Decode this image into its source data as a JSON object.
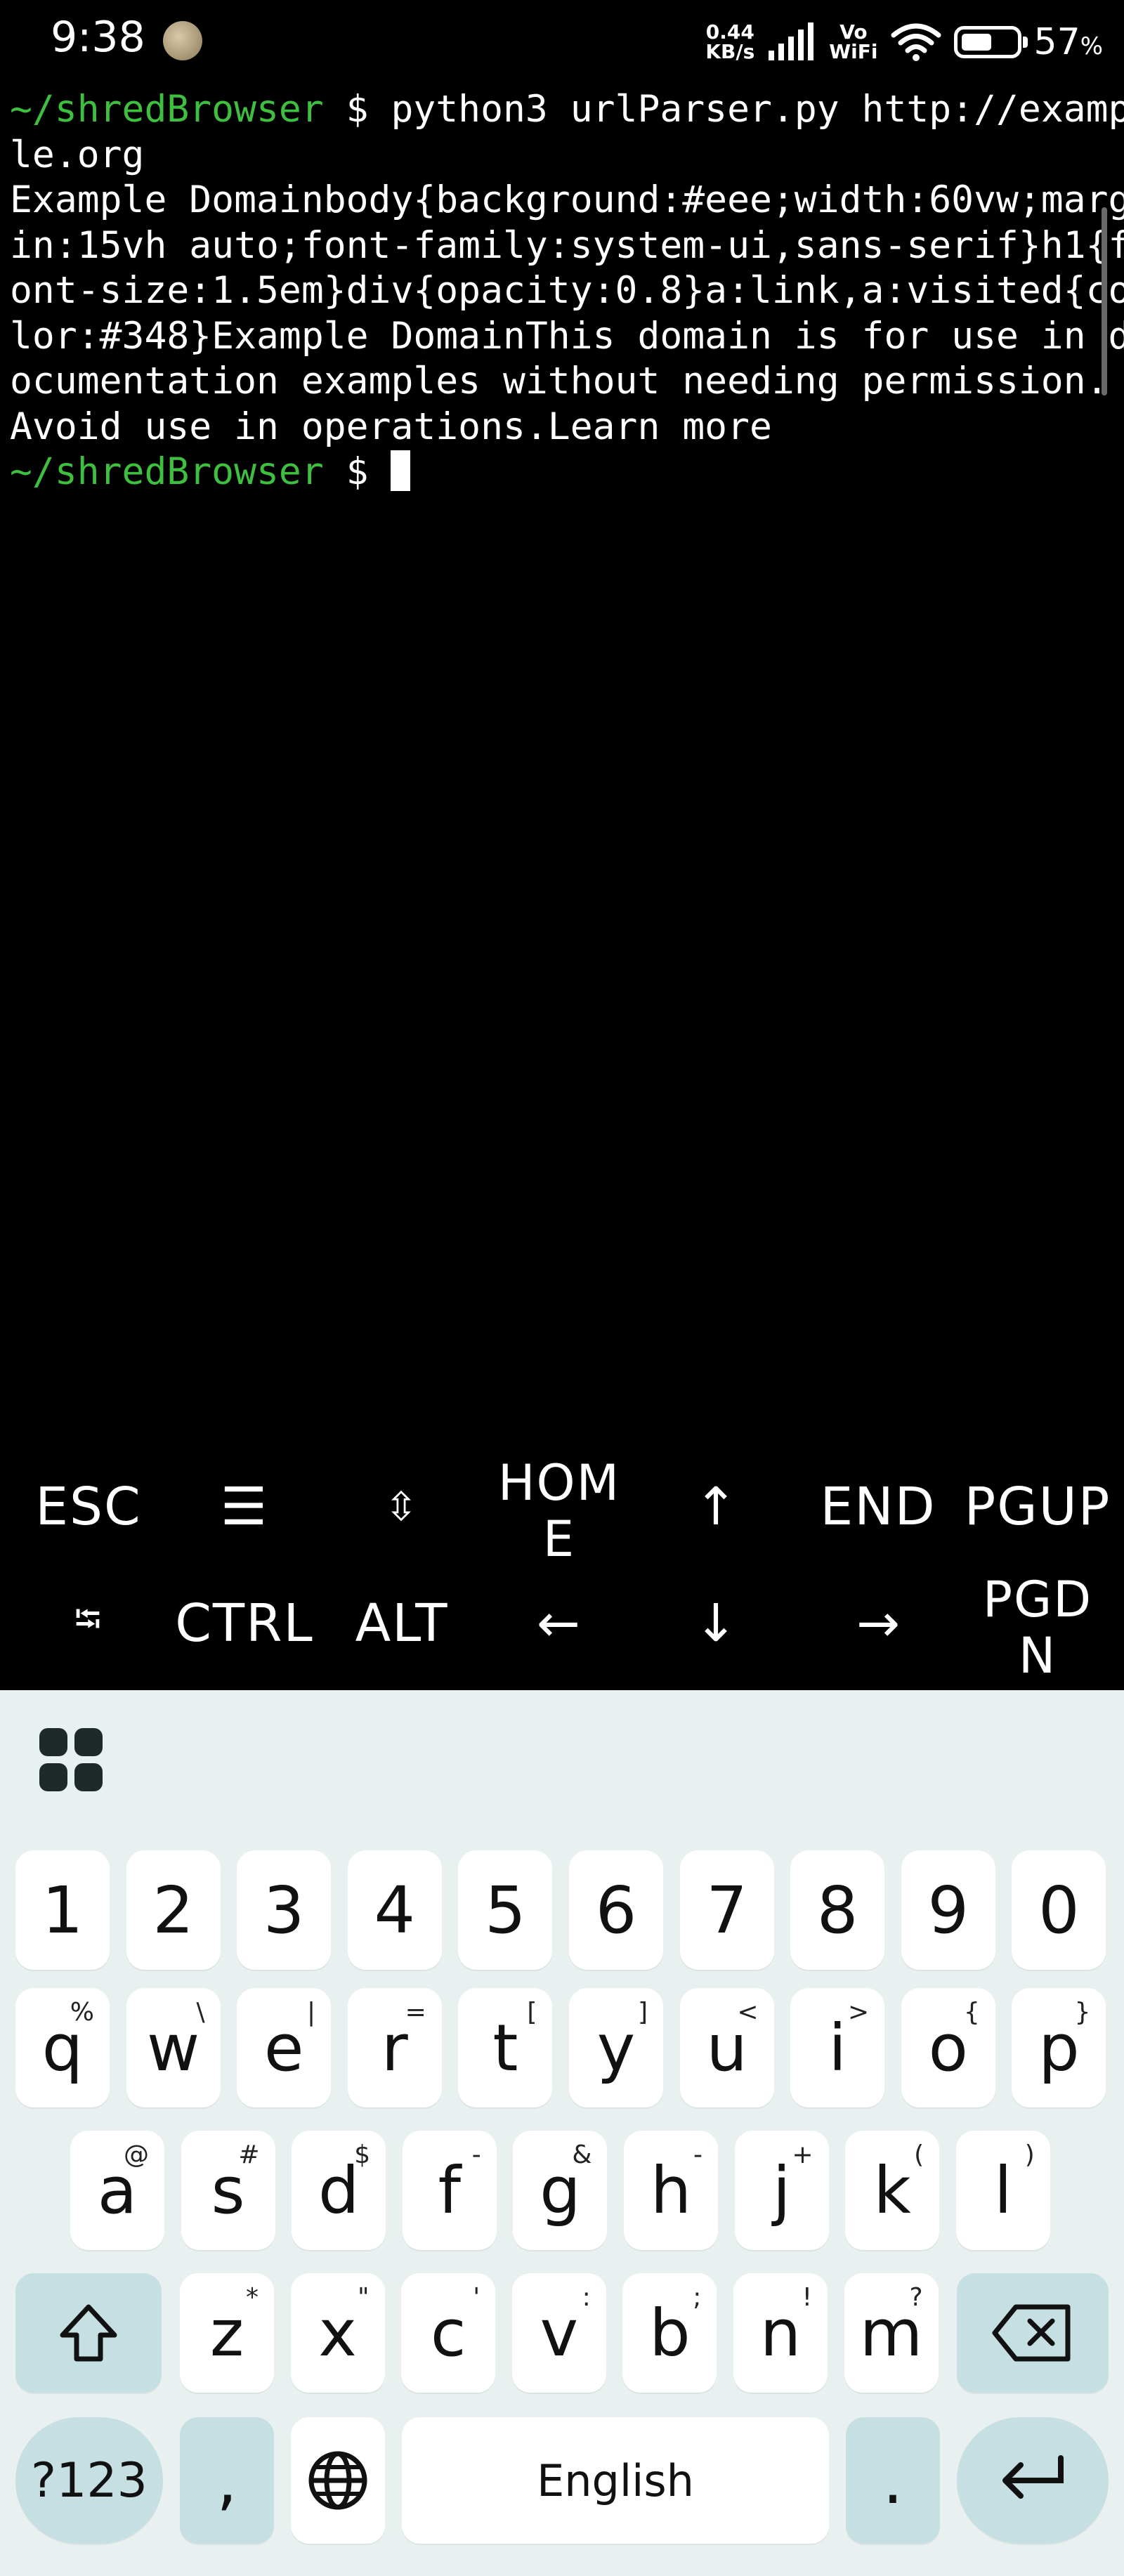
{
  "status_bar": {
    "time": "9:38",
    "net_speed_value": "0.44",
    "net_speed_unit": "KB/s",
    "vo_label": "Vo",
    "wifi_label": "WiFi",
    "battery_percent": 57,
    "battery_text": "57",
    "battery_symbol": "%"
  },
  "terminal": {
    "lines": [
      {
        "prompt": "~/shredBrowser",
        "text": " $ python3 urlParser.py http://examp"
      },
      {
        "prompt": "",
        "text": "le.org"
      },
      {
        "prompt": "",
        "text": "Example Domainbody{background:#eee;width:60vw;marg"
      },
      {
        "prompt": "",
        "text": "in:15vh auto;font-family:system-ui,sans-serif}h1{f"
      },
      {
        "prompt": "",
        "text": "ont-size:1.5em}div{opacity:0.8}a:link,a:visited{co"
      },
      {
        "prompt": "",
        "text": "lor:#348}Example DomainThis domain is for use in d"
      },
      {
        "prompt": "",
        "text": "ocumentation examples without needing permission."
      },
      {
        "prompt": "",
        "text": "Avoid use in operations.Learn more"
      },
      {
        "prompt": "~/shredBrowser",
        "text": " $ "
      }
    ],
    "prompt_color": "#3fbf3f"
  },
  "extra_keys": {
    "row1": [
      {
        "label": "ESC"
      },
      {
        "label": "☰"
      },
      {
        "label": "⇳"
      },
      {
        "label": "HOM",
        "label2": "E"
      },
      {
        "label": "↑"
      },
      {
        "label": "END"
      },
      {
        "label": "PGUP"
      }
    ],
    "row2": [
      {
        "label": "⭾"
      },
      {
        "label": "CTRL"
      },
      {
        "label": "ALT"
      },
      {
        "label": "←"
      },
      {
        "label": "↓"
      },
      {
        "label": "→"
      },
      {
        "label": "PGD",
        "label2": "N"
      }
    ]
  },
  "keyboard": {
    "numbers": [
      "1",
      "2",
      "3",
      "4",
      "5",
      "6",
      "7",
      "8",
      "9",
      "0"
    ],
    "row_q": [
      {
        "k": "q",
        "h": "%"
      },
      {
        "k": "w",
        "h": "\\"
      },
      {
        "k": "e",
        "h": "|"
      },
      {
        "k": "r",
        "h": "="
      },
      {
        "k": "t",
        "h": "["
      },
      {
        "k": "y",
        "h": "]"
      },
      {
        "k": "u",
        "h": "<"
      },
      {
        "k": "i",
        "h": ">"
      },
      {
        "k": "o",
        "h": "{"
      },
      {
        "k": "p",
        "h": "}"
      }
    ],
    "row_a": [
      {
        "k": "a",
        "h": "@"
      },
      {
        "k": "s",
        "h": "#"
      },
      {
        "k": "d",
        "h": "$"
      },
      {
        "k": "f",
        "h": "-"
      },
      {
        "k": "g",
        "h": "&"
      },
      {
        "k": "h",
        "h": "-"
      },
      {
        "k": "j",
        "h": "+"
      },
      {
        "k": "k",
        "h": "("
      },
      {
        "k": "l",
        "h": ")"
      }
    ],
    "row_z": [
      {
        "k": "z",
        "h": "*"
      },
      {
        "k": "x",
        "h": "\""
      },
      {
        "k": "c",
        "h": "'"
      },
      {
        "k": "v",
        "h": ":"
      },
      {
        "k": "b",
        "h": ";"
      },
      {
        "k": "n",
        "h": "!"
      },
      {
        "k": "m",
        "h": "?"
      }
    ],
    "symbols_label": "?123",
    "comma": ",",
    "space_label": "English",
    "period": ".",
    "accent_color": "#c5dfe3",
    "background_color": "#e8f0f0"
  }
}
